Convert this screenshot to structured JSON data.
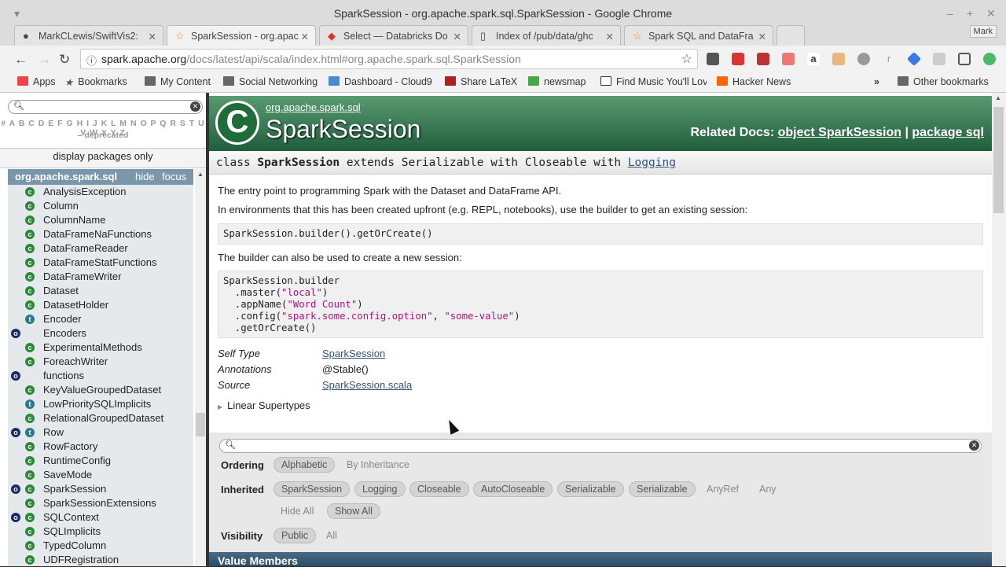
{
  "window": {
    "title": "SparkSession - org.apache.spark.sql.SparkSession - Google Chrome",
    "profile": "Mark"
  },
  "tabs": [
    {
      "label": "MarkCLewis/SwiftVis2:",
      "icon": "github-icon"
    },
    {
      "label": "SparkSession - org.apac",
      "icon": "scaladoc-icon",
      "active": true
    },
    {
      "label": "Select — Databricks Do",
      "icon": "databricks-icon"
    },
    {
      "label": "Index of /pub/data/ghc",
      "icon": "file-icon"
    },
    {
      "label": "Spark SQL and DataFra",
      "icon": "scaladoc-icon"
    }
  ],
  "address": {
    "host": "spark.apache.org",
    "path": "/docs/latest/api/scala/index.html#org.apache.spark.sql.SparkSession"
  },
  "bookmarks": [
    "Apps",
    "Bookmarks",
    "My Content",
    "Social Networking",
    "Dashboard - Cloud9",
    "Share LaTeX",
    "newsmap",
    "Find Music You'll Lov",
    "Hacker News",
    "Other bookmarks"
  ],
  "sidebar": {
    "letters": "# A B C D E F G H I J K L M N O P Q R S T U V W X Y Z",
    "deprecated": "– deprecated",
    "display_packages": "display packages only",
    "package": "org.apache.spark.sql",
    "hide": "hide",
    "focus": "focus",
    "items": [
      {
        "name": "AnalysisException",
        "kinds": "c"
      },
      {
        "name": "Column",
        "kinds": "c"
      },
      {
        "name": "ColumnName",
        "kinds": "c"
      },
      {
        "name": "DataFrameNaFunctions",
        "kinds": "c"
      },
      {
        "name": "DataFrameReader",
        "kinds": "c"
      },
      {
        "name": "DataFrameStatFunctions",
        "kinds": "c"
      },
      {
        "name": "DataFrameWriter",
        "kinds": "c"
      },
      {
        "name": "Dataset",
        "kinds": "c"
      },
      {
        "name": "DatasetHolder",
        "kinds": "c"
      },
      {
        "name": "Encoder",
        "kinds": "t"
      },
      {
        "name": "Encoders",
        "kinds": "o"
      },
      {
        "name": "ExperimentalMethods",
        "kinds": "c"
      },
      {
        "name": "ForeachWriter",
        "kinds": "c"
      },
      {
        "name": "functions",
        "kinds": "o"
      },
      {
        "name": "KeyValueGroupedDataset",
        "kinds": "c"
      },
      {
        "name": "LowPrioritySQLImplicits",
        "kinds": "t"
      },
      {
        "name": "RelationalGroupedDataset",
        "kinds": "c"
      },
      {
        "name": "Row",
        "kinds": "ot"
      },
      {
        "name": "RowFactory",
        "kinds": "c"
      },
      {
        "name": "RuntimeConfig",
        "kinds": "c"
      },
      {
        "name": "SaveMode",
        "kinds": "c"
      },
      {
        "name": "SparkSession",
        "kinds": "oc"
      },
      {
        "name": "SparkSessionExtensions",
        "kinds": "c"
      },
      {
        "name": "SQLContext",
        "kinds": "oc"
      },
      {
        "name": "SQLImplicits",
        "kinds": "c"
      },
      {
        "name": "TypedColumn",
        "kinds": "c"
      },
      {
        "name": "UDFRegistration",
        "kinds": "c"
      }
    ]
  },
  "main": {
    "package_path": "org.apache.spark.sql",
    "class_name": "SparkSession",
    "related_label": "Related Docs:",
    "related_object": "object SparkSession",
    "related_sep": "|",
    "related_package": "package sql",
    "signature": {
      "kw": "class",
      "name": "SparkSession",
      "rest": "extends Serializable with Closeable with",
      "link": "Logging"
    },
    "desc1": "The entry point to programming Spark with the Dataset and DataFrame API.",
    "desc2": "In environments that this has been created upfront (e.g. REPL, notebooks), use the builder to get an existing session:",
    "code1": "SparkSession.builder().getOrCreate()",
    "desc3": "The builder can also be used to create a new session:",
    "code2": {
      "l1": "SparkSession.builder",
      "l2a": "  .master(",
      "l2s": "\"local\"",
      "l2b": ")",
      "l3a": "  .appName(",
      "l3s": "\"Word Count\"",
      "l3b": ")",
      "l4a": "  .config(",
      "l4s": "\"spark.some.config.option\"",
      "l4c": ", ",
      "l4s2": "\"some-value\"",
      "l4b": ")",
      "l5": "  .getOrCreate()"
    },
    "attrs": [
      {
        "k": "Self Type",
        "v": "SparkSession",
        "link": true
      },
      {
        "k": "Annotations",
        "v": "@Stable()",
        "link": false
      },
      {
        "k": "Source",
        "v": "SparkSession.scala",
        "link": true
      }
    ],
    "linear_supertypes": "Linear Supertypes",
    "ordering": {
      "label": "Ordering",
      "options": [
        "Alphabetic",
        "By Inheritance"
      ]
    },
    "inherited": {
      "label": "Inherited",
      "options": [
        "SparkSession",
        "Logging",
        "Closeable",
        "AutoCloseable",
        "Serializable",
        "Serializable",
        "AnyRef",
        "Any"
      ],
      "hide_all": "Hide All",
      "show_all": "Show All"
    },
    "visibility": {
      "label": "Visibility",
      "options": [
        "Public",
        "All"
      ]
    },
    "value_members": "Value Members"
  },
  "colors": {
    "header_green": "#2a6e45",
    "package_bar": "#7996ac",
    "value_members_bar": "#3a5a74",
    "link": "#315479",
    "string": "#b0137a"
  }
}
